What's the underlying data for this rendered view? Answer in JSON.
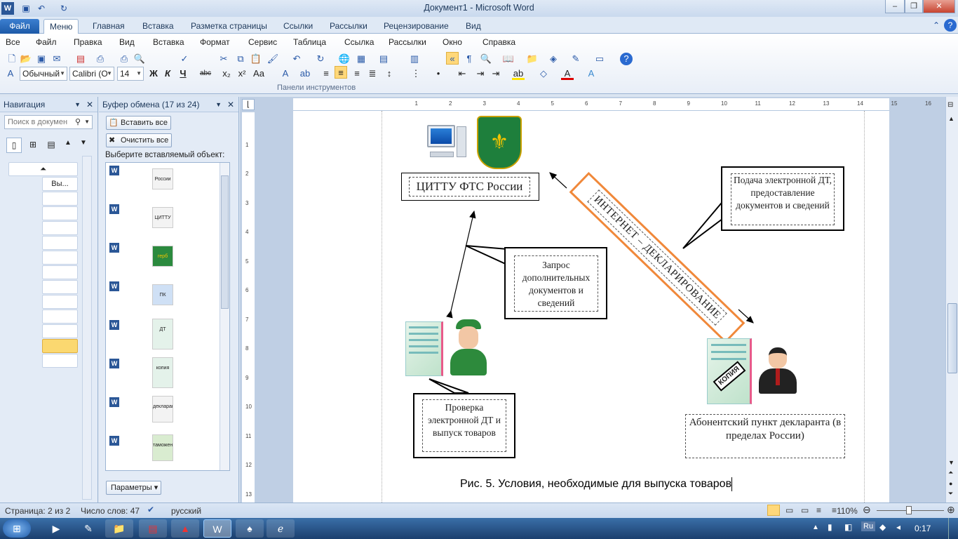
{
  "window": {
    "title": "Документ1 - Microsoft Word"
  },
  "tabs": [
    "Файл",
    "Меню",
    "Главная",
    "Вставка",
    "Разметка страницы",
    "Ссылки",
    "Рассылки",
    "Рецензирование",
    "Вид"
  ],
  "menu": [
    "Все",
    "Файл",
    "Правка",
    "Вид",
    "Вставка",
    "Формат",
    "Сервис",
    "Таблица",
    "Ссылка",
    "Рассылки",
    "Окно",
    "Справка"
  ],
  "toolbar": {
    "style": "Обычный",
    "font": "Calibri (О",
    "size": "14",
    "panel_caption": "Панели инструментов"
  },
  "nav": {
    "title": "Навигация",
    "search_placeholder": "Поиск в докумен",
    "item_label": "Вы..."
  },
  "clipboard": {
    "title": "Буфер обмена (17 из 24)",
    "paste_all": "Вставить все",
    "clear_all": "Очистить все",
    "choose": "Выберите вставляемый объект:",
    "options": "Параметры",
    "thumbs": [
      "России",
      "ЦИТТУ",
      "герб",
      "ПК",
      "ДТ",
      "копия",
      "декларант",
      "таможенник"
    ]
  },
  "doc": {
    "ftc_label": "ЦИТТУ ФТС России",
    "banner": "ИНТЕРНЕТ – ДЕКЛАРИРОВАНИЕ",
    "callout_top": "Подача электронной ДТ, предоставление документов и сведений",
    "callout_mid": "Запрос дополнительных документов и сведений",
    "callout_bottom": "Проверка электронной ДТ и выпуск товаров",
    "subscriber": "Абонентский пункт декларанта (в пределах России)",
    "stamp": "КОПИЯ",
    "caption": "Рис. 5. Условия, необходимые для выпуска товаров"
  },
  "status": {
    "page": "Страница: 2 из 2",
    "words": "Число слов: 47",
    "lang": "русский",
    "zoom": "110%"
  },
  "taskbar": {
    "lang": "Ru",
    "time": "0:17"
  }
}
